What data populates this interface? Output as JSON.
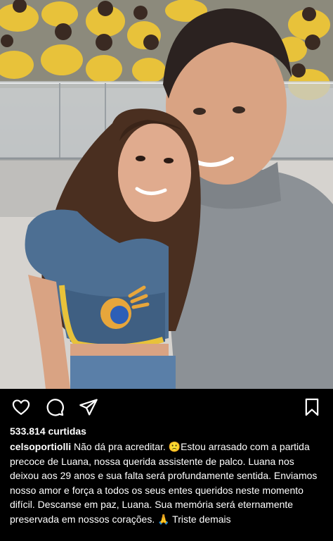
{
  "post": {
    "image_alt": "Selfie of a smiling man in a grey turtleneck and a smiling woman in a denim top, in a TV studio audience with people in yellow shirts",
    "likes": "533.814 curtidas",
    "username": "celsoportiolli",
    "caption": "Não dá pra acreditar. 🙁Estou arrasado com a partida precoce de Luana, nossa querida assistente de palco. Luana nos deixou aos 29 anos e sua falta será profundamente sentida. Enviamos nosso amor e força a todos os seus entes queridos neste momento difícil. Descanse em paz, Luana. Sua memória será eternamente preservada em nossos corações. 🙏 Triste demais"
  },
  "icons": {
    "like": "heart-icon",
    "comment": "comment-icon",
    "share": "send-icon",
    "save": "bookmark-icon"
  },
  "colors": {
    "background": "#000000",
    "text": "#ffffff",
    "audience_shirt": "#e8c23a"
  }
}
